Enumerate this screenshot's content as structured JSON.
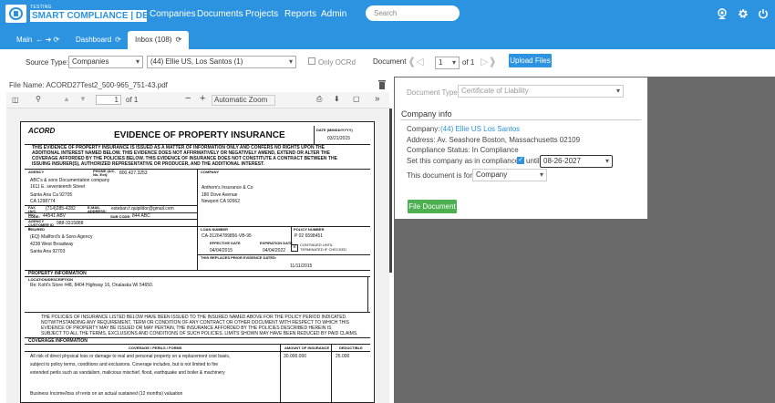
{
  "brand": {
    "small": "TESTING",
    "word": "SMART COMPLIANCE | DEV"
  },
  "nav": {
    "companies": "Companies",
    "documents": "Documents",
    "projects": "Projects",
    "reports": "Reports",
    "admin": "Admin"
  },
  "search": {
    "placeholder": "Search"
  },
  "tabs": {
    "main": "Main",
    "dashboard": "Dashboard",
    "inbox": "Inbox (108)"
  },
  "toolbar": {
    "source_label": "Source Type:",
    "source_value": "Companies",
    "company_value": "(44) Ellie US, Los Santos (1)",
    "only_ocr": "Only OCRd",
    "document_label": "Document",
    "doc_page": "1",
    "doc_of": "of 1",
    "upload": "Upload Files"
  },
  "file": {
    "name": "File Name: ACORD27Test2_500-965_751-43.pdf"
  },
  "pdf_toolbar": {
    "page": "1",
    "of": "of 1",
    "zoom": "Automatic Zoom"
  },
  "doc": {
    "acord": "ACORD",
    "title": "EVIDENCE OF PROPERTY INSURANCE",
    "date_hdr": "DATE (MM/DD/YYYY)",
    "date": "03/21/2015",
    "disclaimer1": "THIS EVIDENCE OF PROPERTY INSURANCE IS ISSUED AS A MATTER OF INFORMATION ONLY AND CONFERS NO RIGHTS UPON THE",
    "disclaimer2": "ADDITIONAL INTEREST NAMED BELOW. THIS EVIDENCE DOES NOT AFFIRMATIVELY OR NEGATIVELY AMEND, EXTEND OR ALTER THE",
    "disclaimer3": "COVERAGE AFFORDED BY THE POLICIES BELOW. THIS EVIDENCE OF INSURANCE DOES NOT CONSTITUTE A CONTRACT BETWEEN THE",
    "disclaimer4": "ISSUING INSURER(S), AUTHORIZED REPRESENTATIVE OR PRODUCER, AND THE ADDITIONAL INTEREST.",
    "agency_hdr": "AGENCY",
    "phone_hdr": "PHONE (A/C, No, Ext):",
    "phone": "800.427.3253",
    "agency1": "ABC's & sons Documentation company",
    "agency2": "1611 E. seventeenth Street",
    "agency3": "Santa Ana  Ca 92705",
    "agency4": "CA 1298774",
    "fax_hdr": "FAX (A/C, No):",
    "fax": "(714)285-4282",
    "email_hdr": "E-MAIL ADDRESS:",
    "email": "esteban.f.quipildor@gmail.com",
    "code_hdr": "CODE:",
    "code": "44541 ABV",
    "subcode_hdr": "SUB CODE:",
    "subcode": "844 ABC",
    "custid_hdr": "AGENCY CUSTOMER ID #:",
    "custid": "988-3315888",
    "company_hdr": "COMPANY",
    "company1": "Anthem's Insurance & Co",
    "company2": "180 Dove Avenue",
    "company3": "Newport CA 92662",
    "insured_hdr": "INSURED",
    "insured1": "(EQ) Mailford's & Sons Agency",
    "insured2": "4238 West Broadway",
    "insured3": "Santa Ana 92703",
    "loan_hdr": "LOAN NUMBER",
    "loan": "CA-31264789856-VB-95",
    "policy_hdr": "POLICY NUMBER",
    "policy": "P 02 6598451",
    "eff_hdr": "EFFECTIVE DATE",
    "eff": "04/04/2015",
    "exp_hdr": "EXPIRATION DATE",
    "exp": "04/04/2022",
    "cont1": "CONTINUED UNTIL",
    "cont2": "TERMINATED IF CHECKED",
    "replaces": "THIS REPLACES PRIOR EVIDENCE DATED:",
    "replaces_date": "11/11/2015",
    "prop_hdr": "PROPERTY INFORMATION",
    "loc_hdr": "LOCATION/DESCRIPTION",
    "loc": "Re: Kohl's Store #48, 8404 Highway 16, Onalaska WI 54650.",
    "pol1": "THE POLICIES OF INSURANCE LISTED BELOW HAVE BEEN ISSUED TO THE INSURED NAMED ABOVE FOR THE POLICY PERIOD INDICATED.",
    "pol2": "NOTWITHSTANDING ANY REQUIREMENT, TERM OR CONDITION OF ANY CONTRACT OR OTHER DOCUMENT WITH RESPECT TO WHICH THIS",
    "pol3": "EVIDENCE OF PROPERTY MAY BE ISSUED OR MAY PERTAIN, THE INSURANCE AFFORDED BY THE POLICIES DESCRIBED HEREIN IS",
    "pol4": "SUBJECT TO ALL THE TERMS, EXCLUSIONS AND CONDITIONS OF SUCH POLICIES.  LIMITS SHOWN MAY HAVE BEEN REDUCED BY PAID CLAIMS.",
    "cov_hdr": "COVERAGE INFORMATION",
    "perils_hdr": "COVERAGE / PERILS / FORMS",
    "amount_hdr": "AMOUNT OF INSURANCE",
    "ded_hdr": "DEDUCTIBLE",
    "cov1": "All risk of direct physical  loss or damage to real and personal property on a replacement cost basis,",
    "cov2": "subject to policy terms, conditions and exclusions. Coverage includes, but is not limited to fire",
    "cov3": "extended perils such as vandalism, malicious mischief, flood, earthquake and boiler & machinery",
    "amount": "30.000.000",
    "ded": "25.000",
    "cov4": "Business Income/loss of rents on an actual sustained (12 months) valuation"
  },
  "panel": {
    "doc_type_label": "Document Type:",
    "doc_type_value": "Certificate of Liability",
    "company_info": "Company info",
    "company_label": "Company:",
    "company_link": "(44) Ellie US Los Santos",
    "address": "Address:  Av. Seashore Boston, Massachusetts 02109",
    "status": "Compliance Status:  In Compliance",
    "set_label": "Set this company as in compliance",
    "until": "until",
    "until_date": "08-26-2027",
    "for_label": "This document is for:",
    "for_value": "Company",
    "file_btn": "File Document"
  }
}
